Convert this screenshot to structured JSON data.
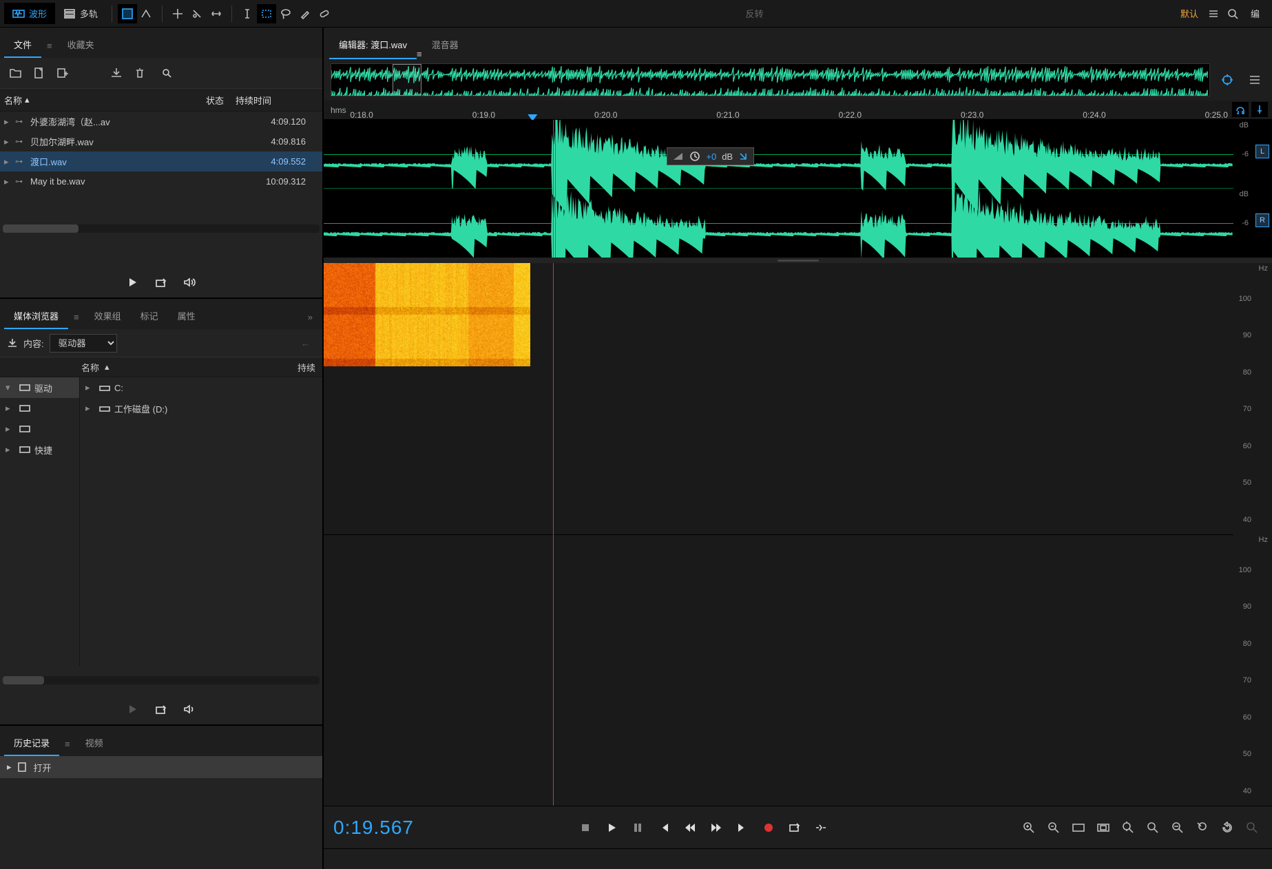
{
  "topbar": {
    "mode_waveform": "波形",
    "mode_multitrack": "多轨",
    "center_label": "反转",
    "right_default": "默认",
    "right_edit": "编"
  },
  "files_panel": {
    "tab_files": "文件",
    "tab_fav": "收藏夹",
    "header_name": "名称",
    "header_status": "状态",
    "header_duration": "持续时间"
  },
  "files": [
    {
      "name": "外婆澎湖湾（赵...av",
      "duration": "4:09.120"
    },
    {
      "name": "贝加尔湖畔.wav",
      "duration": "4:09.816"
    },
    {
      "name": "渡口.wav",
      "duration": "4:09.552"
    },
    {
      "name": "May it be.wav",
      "duration": "10:09.312"
    }
  ],
  "selected_file_index": 2,
  "media_panel": {
    "tab_media": "媒体浏览器",
    "tab_fxgroup": "效果组",
    "tab_markers": "标记",
    "tab_props": "属性",
    "content_label": "内容:",
    "content_value": "驱动器",
    "tree_header_name": "名称",
    "tree_header_dur": "持续",
    "left_tree": [
      {
        "label": "驱动",
        "selected": true,
        "icon": "drive"
      },
      {
        "label": "",
        "icon": "folder"
      },
      {
        "label": "",
        "icon": "folder"
      },
      {
        "label": "快捷",
        "icon": "shortcut"
      }
    ],
    "right_tree": [
      {
        "label": "C:"
      },
      {
        "label": "工作磁盘 (D:)"
      }
    ]
  },
  "history_panel": {
    "tab_history": "历史记录",
    "tab_video": "视频",
    "item_open": "打开"
  },
  "editor": {
    "tab_editor_prefix": "编辑器: ",
    "tab_editor_file": "渡口.wav",
    "tab_mixer": "混音器"
  },
  "timeline": {
    "hms_label": "hms",
    "ticks": [
      "0:18.0",
      "0:19.0",
      "0:20.0",
      "0:21.0",
      "0:22.0",
      "0:23.0",
      "0:24.0",
      "0:25.0"
    ],
    "playhead_time": "0:19.567",
    "marker_time": "0:19.4"
  },
  "waveform": {
    "db_unit": "dB",
    "db_scale": [
      "-6"
    ],
    "channel_left": "L",
    "channel_right": "R",
    "hud_gain": "+0",
    "hud_unit": "dB",
    "overview_sel_start_pct": 7.0,
    "overview_sel_end_pct": 10.3
  },
  "spectrogram": {
    "hz_unit": "Hz",
    "hz_scale_top": [
      "100",
      "90",
      "80",
      "70",
      "60",
      "50",
      "40"
    ],
    "hz_scale_bot": [
      "100",
      "90",
      "80",
      "70",
      "60",
      "50",
      "40"
    ]
  },
  "bottom": {
    "timecode": "0:19.567"
  }
}
